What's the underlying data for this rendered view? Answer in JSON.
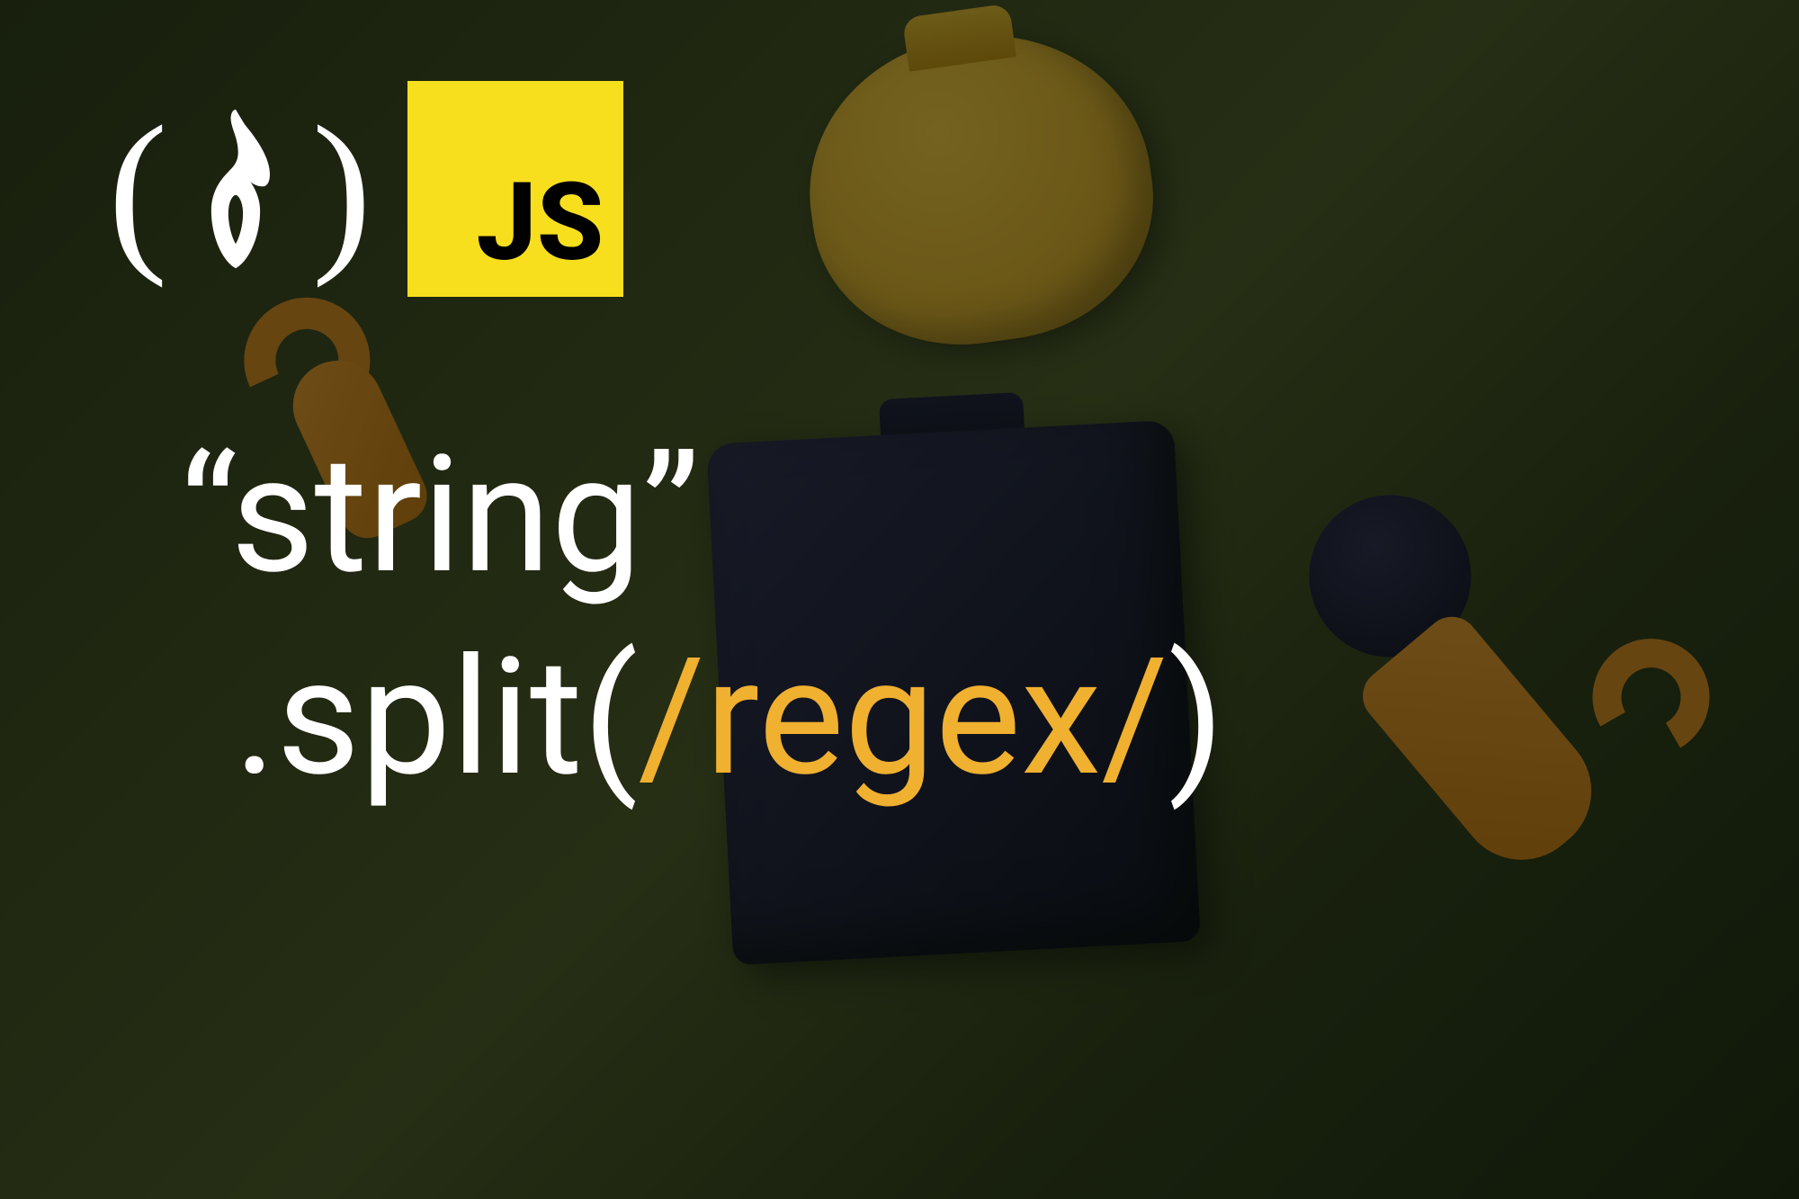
{
  "logos": {
    "fcc_left_paren": "(",
    "fcc_right_paren": ")",
    "js_label": "JS"
  },
  "code": {
    "line1": "“string”",
    "line2_prefix": ".split(",
    "line2_regex": "/regex/",
    "line2_suffix": ")"
  },
  "colors": {
    "js_yellow": "#f7df1e",
    "regex_orange": "#f0b030",
    "text_white": "#ffffff"
  }
}
